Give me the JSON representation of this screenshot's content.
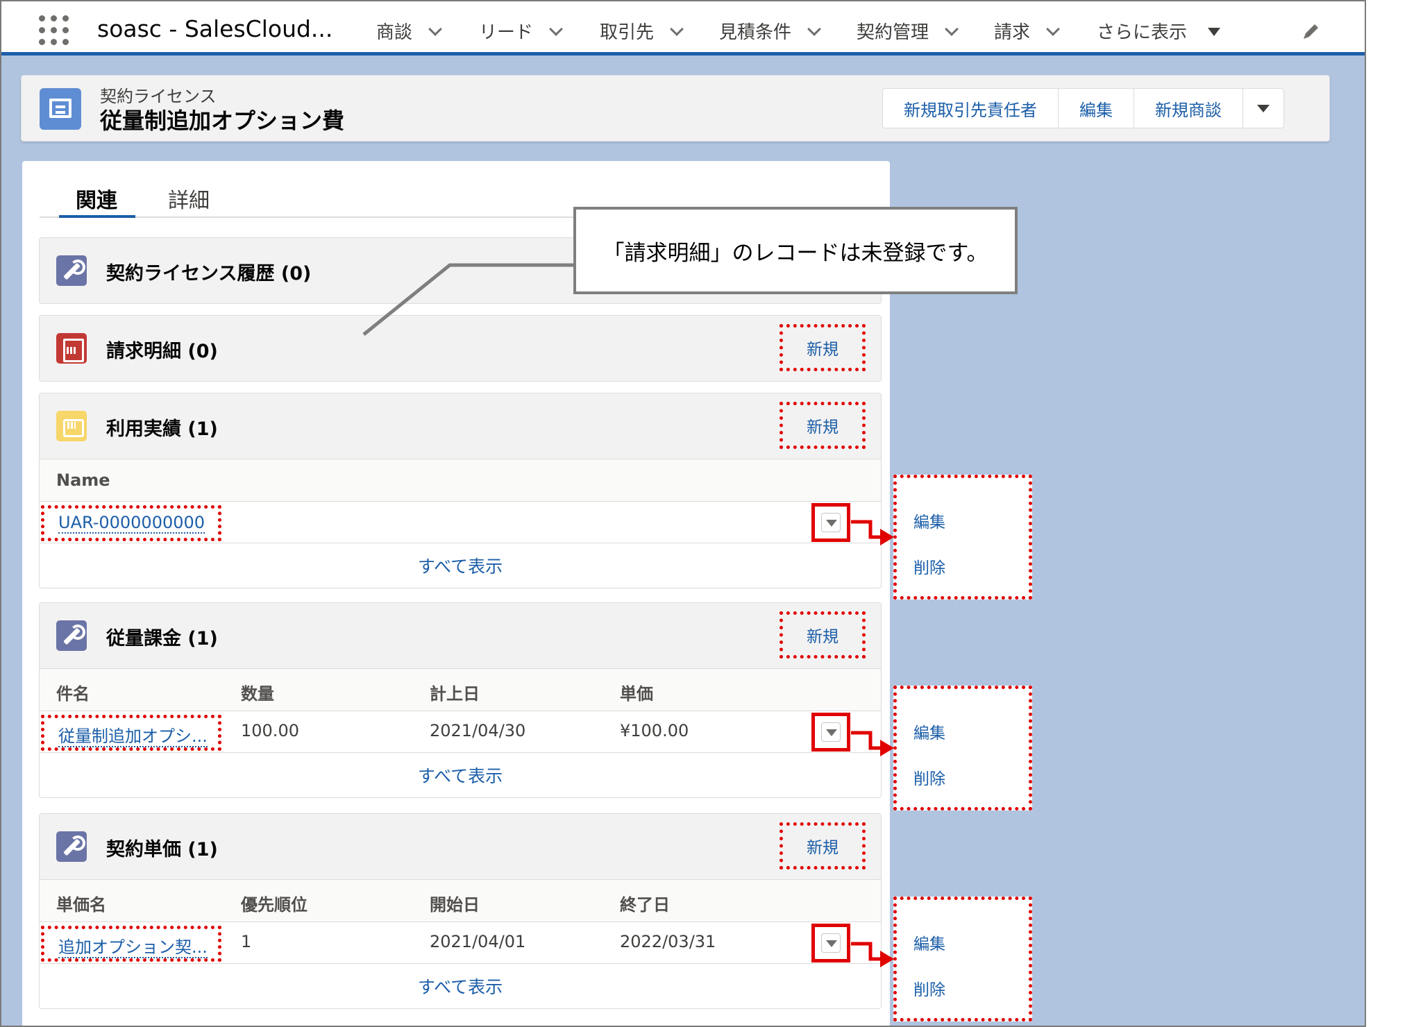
{
  "nav": {
    "app_name": "soasc - SalesCloud...",
    "items": [
      "商談",
      "リード",
      "取引先",
      "見積条件",
      "契約管理",
      "請求",
      "さらに表示"
    ]
  },
  "record": {
    "type": "契約ライセンス",
    "title": "従量制追加オプション費",
    "actions": [
      "新規取引先責任者",
      "編集",
      "新規商談"
    ]
  },
  "tabs": {
    "related": "関連",
    "detail": "詳細"
  },
  "callout": "「請求明細」のレコードは未登録です。",
  "new_label": "新規",
  "view_all_label": "すべて表示",
  "menu": {
    "edit": "編集",
    "delete": "削除"
  },
  "panels": {
    "history": {
      "title": "契約ライセンス履歴 (0)"
    },
    "billing": {
      "title": "請求明細 (0)"
    },
    "usage": {
      "title": "利用実績 (1)",
      "columns": [
        "Name"
      ],
      "row": [
        "UAR-0000000000"
      ]
    },
    "metered": {
      "title": "従量課金 (1)",
      "columns": [
        "件名",
        "数量",
        "計上日",
        "単価"
      ],
      "row": [
        "従量制追加オプシ...",
        "100.00",
        "2021/04/30",
        "¥100.00"
      ]
    },
    "unitprice": {
      "title": "契約単価 (1)",
      "columns": [
        "単価名",
        "優先順位",
        "開始日",
        "終了日"
      ],
      "row": [
        "追加オプション契...",
        "1",
        "2021/04/01",
        "2022/03/31"
      ]
    }
  },
  "colors": {
    "accent": "#1b5ea8",
    "highlight": "#e00000",
    "background": "#b0c4df"
  }
}
